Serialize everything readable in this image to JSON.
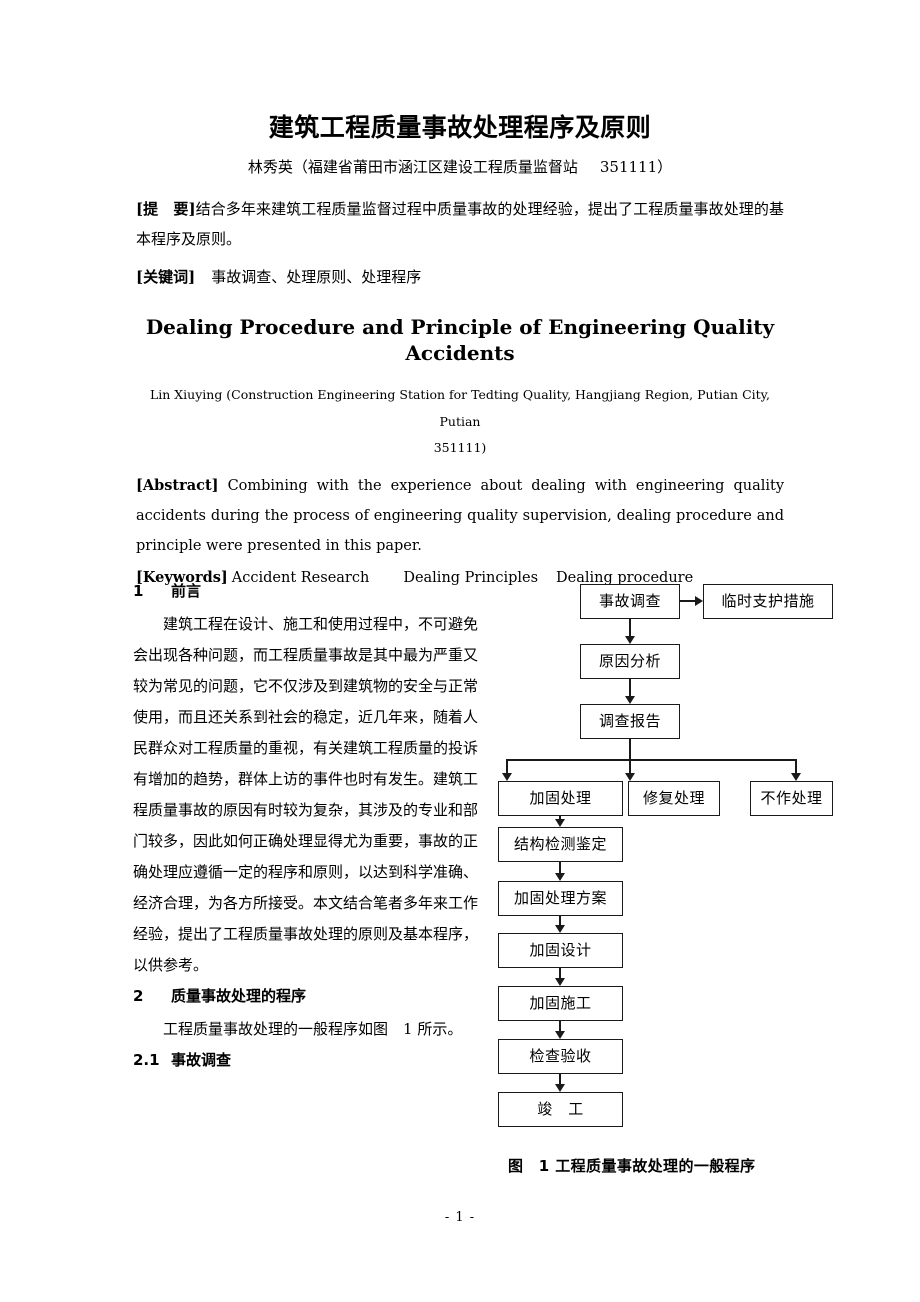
{
  "paper": {
    "title_zh": "建筑工程质量事故处理程序及原则",
    "author_zh": "林秀英（福建省莆田市涵江区建设工程质量监督站",
    "author_zip_zh": "351111）",
    "abstract_label_zh": "[提　要]",
    "abstract_text_zh": "结合多年来建筑工程质量监督过程中质量事故的处理经验，提出了工程质量事故处理的基本程序及原则。",
    "keywords_label_zh": "[关键词]",
    "keywords_text_zh": "事故调查、处理原则、处理程序",
    "title_en": "Dealing Procedure and Principle of Engineering Quality Accidents",
    "author_en": "Lin Xiuying (Construction Engineering Station for Tedting Quality, Hangjiang Region, Putian City, Putian",
    "author_zip_en": "351111)",
    "abstract_label_en": "[Abstract]",
    "abstract_text_en": "Combining with the experience about dealing with engineering quality accidents during the process of engineering quality supervision, dealing procedure and principle were presented in this paper.",
    "keywords_label_en": "[Keywords]",
    "keyword_en_1": "Accident Research",
    "keyword_en_2": "Dealing Principles",
    "keyword_en_3": "Dealing procedure"
  },
  "sections": {
    "s1_num": "1",
    "s1_title": "前言",
    "s1_para": "建筑工程在设计、施工和使用过程中，不可避免会出现各种问题，而工程质量事故是其中最为严重又较为常见的问题，它不仅涉及到建筑物的安全与正常使用，而且还关系到社会的稳定，近几年来，随着人民群众对工程质量的重视，有关建筑工程质量的投诉有增加的趋势，群体上访的事件也时有发生。建筑工程质量事故的原因有时较为复杂，其涉及的专业和部门较多，因此如何正确处理显得尤为重要，事故的正确处理应遵循一定的程序和原则，以达到科学准确、经济合理，为各方所接受。本文结合笔者多年来工作经验，提出了工程质量事故处理的原则及基本程序，以供参考。",
    "s2_num": "2",
    "s2_title": "质量事故处理的程序",
    "s2_para": "工程质量事故处理的一般程序如图　1 所示。",
    "s3_num": "2.1",
    "s3_title": "事故调查"
  },
  "figure": {
    "caption": "图　1 工程质量事故处理的一般程序",
    "boxes": {
      "accident_investigation": "事故调查",
      "temporary_support": "临时支护措施",
      "cause_analysis": "原因分析",
      "investigation_report": "调查报告",
      "reinforcement_treatment": "加固处理",
      "repair_treatment": "修复处理",
      "no_treatment": "不作处理",
      "structure_inspection": "结构检测鉴定",
      "reinforcement_plan": "加固处理方案",
      "reinforcement_design": "加固设计",
      "reinforcement_construction": "加固施工",
      "inspection_acceptance": "检查验收",
      "completion": "竣　工"
    }
  },
  "footer": {
    "page_number": "- 1 -"
  }
}
